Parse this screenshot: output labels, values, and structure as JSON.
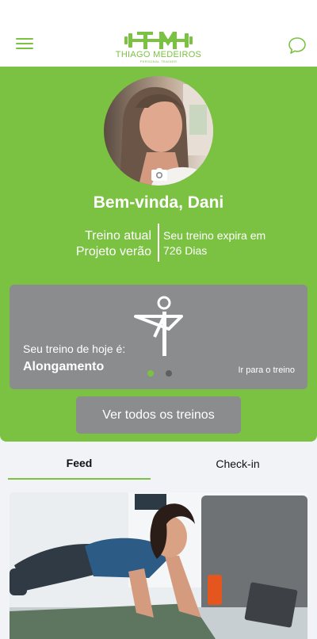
{
  "header": {
    "menu_icon": "hamburger-icon",
    "chat_icon": "chat-bubble-icon",
    "logo": {
      "name": "THIAGO MEDEIROS",
      "subtitle": "PERSONAL TRAINER"
    }
  },
  "profile": {
    "camera_icon": "camera-icon",
    "welcome": "Bem-vinda, Dani",
    "plan_label": "Treino atual",
    "plan_name": "Projeto verão",
    "expiry_label": "Seu treino expira em",
    "expiry_value": "726 Dias"
  },
  "today_card": {
    "icon": "yoga-pose-icon",
    "caption": "Seu treino de hoje é:",
    "title": "Alongamento",
    "link": "Ir para o treino",
    "pages": 2,
    "active_page": 1
  },
  "see_all_button": "Ver todos os treinos",
  "tabs": [
    {
      "label": "Feed",
      "active": true
    },
    {
      "label": "Check-in",
      "active": false
    }
  ],
  "colors": {
    "brand_green": "#7bc142",
    "card_gray": "#8b8c8e",
    "background": "#f1f3f7"
  }
}
